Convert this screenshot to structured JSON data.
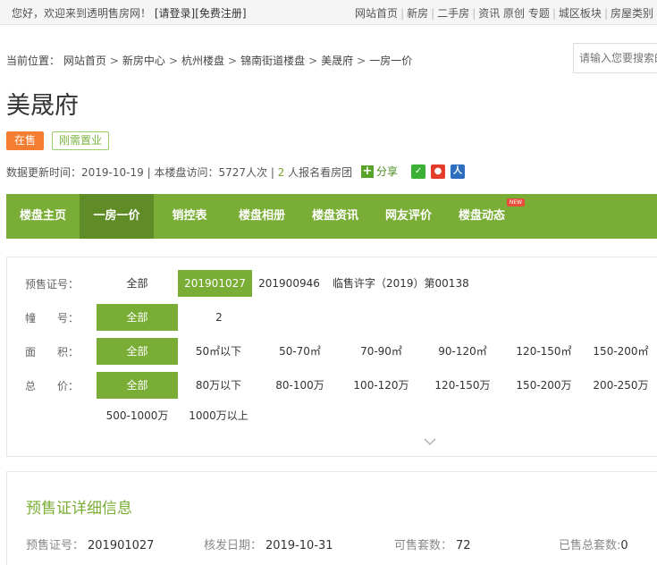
{
  "topbar": {
    "welcome": "您好，欢迎来到透明售房网！",
    "login": "[请登录]",
    "register": "[免费注册]",
    "nav": [
      "网站首页",
      "新房",
      "二手房",
      "资讯 原创 专题",
      "城区板块",
      "房屋类别"
    ]
  },
  "breadcrumb": {
    "prefix": "当前位置：",
    "items": [
      "网站首页",
      "新房中心",
      "杭州楼盘",
      "锦南街道楼盘",
      "美晟府",
      "一房一价"
    ],
    "arrow": ">"
  },
  "search": {
    "placeholder": "请输入您要搜索的"
  },
  "title": "美晟府",
  "tags": {
    "sale": "在售",
    "need": "刚需置业"
  },
  "meta": {
    "update_label": "数据更新时间：",
    "update_date": "2019-10-19",
    "visit_label": "本楼盘访问：",
    "visit_count": "5727人次",
    "signup_count": "2",
    "signup_text": "人报名看房团"
  },
  "share": {
    "label": "分享",
    "icons": [
      "wechat-icon",
      "weibo-icon",
      "renren-icon"
    ]
  },
  "gnav": {
    "items": [
      "楼盘主页",
      "一房一价",
      "销控表",
      "楼盘相册",
      "楼盘资讯",
      "网友评价",
      "楼盘动态"
    ],
    "active": "一房一价",
    "new_badge": "NEW"
  },
  "filters": {
    "permit": {
      "label": "预售证号：",
      "options": [
        "全部",
        "201901027",
        "201900946",
        "临售许字（2019）第00138"
      ],
      "selected": "201901027"
    },
    "building": {
      "label": "幢　　号：",
      "options": [
        "全部",
        "2"
      ],
      "selected": "全部"
    },
    "area": {
      "label": "面　　积：",
      "options": [
        "全部",
        "50㎡以下",
        "50-70㎡",
        "70-90㎡",
        "90-120㎡",
        "120-150㎡",
        "150-200㎡"
      ],
      "selected": "全部"
    },
    "price": {
      "label": "总　　价：",
      "options": [
        "全部",
        "80万以下",
        "80-100万",
        "100-120万",
        "120-150万",
        "150-200万",
        "200-250万",
        "500-1000万",
        "1000万以上"
      ],
      "selected": "全部"
    }
  },
  "details": {
    "title": "预售证详细信息",
    "permit_label": "预售证号：",
    "permit_value": "201901027",
    "issue_label": "核发日期：",
    "issue_value": "2019-10-31",
    "available_label": "可售套数：",
    "available_value": "72",
    "sold_label": "已售总套数:",
    "sold_value": "0"
  },
  "colors": {
    "green": "#7aad35",
    "green_dark": "#5f8c26",
    "orange": "#f57d32"
  }
}
